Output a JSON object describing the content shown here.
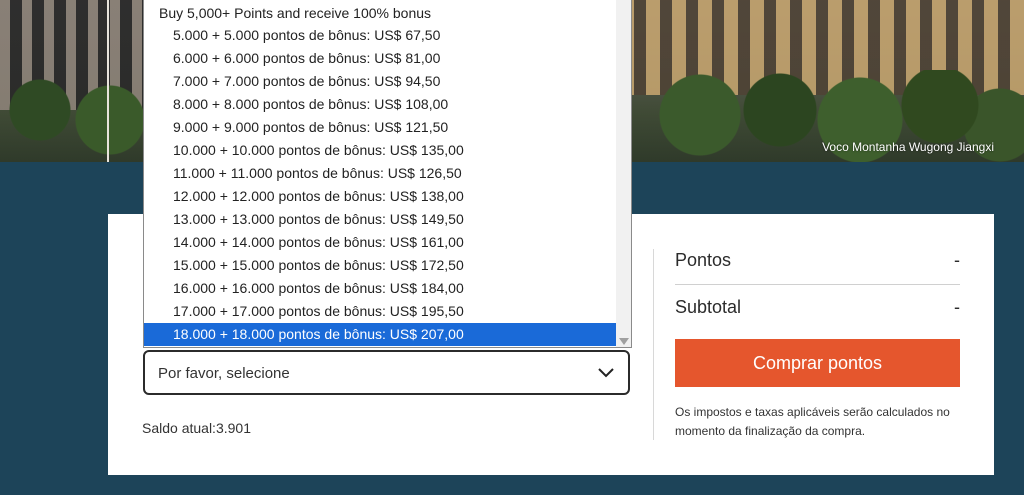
{
  "hero": {
    "caption": "Voco Montanha Wugong Jiangxi"
  },
  "dropdown": {
    "group_label": "Buy 5,000+ Points and receive 100% bonus",
    "options": [
      "5.000 + 5.000 pontos de bônus: US$ 67,50",
      "6.000 + 6.000 pontos de bônus: US$ 81,00",
      "7.000 + 7.000 pontos de bônus: US$ 94,50",
      "8.000 + 8.000 pontos de bônus: US$ 108,00",
      "9.000 + 9.000 pontos de bônus: US$ 121,50",
      "10.000 + 10.000 pontos de bônus: US$ 135,00",
      "11.000 + 11.000 pontos de bônus: US$ 126,50",
      "12.000 + 12.000 pontos de bônus: US$ 138,00",
      "13.000 + 13.000 pontos de bônus: US$ 149,50",
      "14.000 + 14.000 pontos de bônus: US$ 161,00",
      "15.000 + 15.000 pontos de bônus: US$ 172,50",
      "16.000 + 16.000 pontos de bônus: US$ 184,00",
      "17.000 + 17.000 pontos de bônus: US$ 195,50",
      "18.000 + 18.000 pontos de bônus: US$ 207,00"
    ],
    "highlighted_option": "18.000 + 18.000 pontos de bônus: US$ 207,00"
  },
  "form": {
    "select_value": "Por favor, selecione",
    "balance_label": "Saldo atual:",
    "balance_value": "3.901"
  },
  "summary": {
    "points_label": "Pontos",
    "points_value": "-",
    "subtotal_label": "Subtotal",
    "subtotal_value": "-",
    "buy_button": "Comprar pontos",
    "tax_note": "Os impostos e taxas aplicáveis serão calculados no momento da finalização da compra."
  },
  "colors": {
    "page_background": "#1d4459",
    "accent_button": "#e5562d",
    "selected_option": "#1a6ad8"
  }
}
